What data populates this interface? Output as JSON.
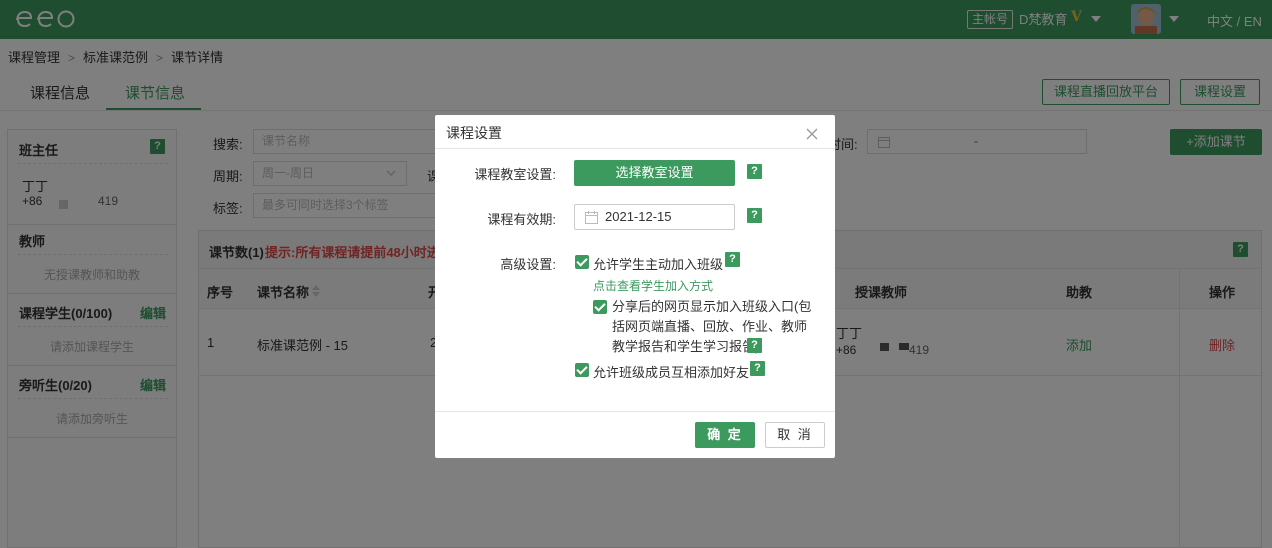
{
  "header": {
    "account_badge": "主帐号",
    "org_name": "D梵教育",
    "vip_mark": "V",
    "language": "中文 / EN"
  },
  "breadcrumb": [
    "课程管理",
    "标准课范例",
    "课节详情"
  ],
  "tabs": [
    {
      "label": "课程信息",
      "active": false
    },
    {
      "label": "课节信息",
      "active": true
    }
  ],
  "actions": {
    "live_platform": "课程直播回放平台",
    "course_settings": "课程设置",
    "add_lesson": "+添加课节"
  },
  "sidebar": {
    "head_teacher_title": "班主任",
    "head_teacher_name": "丁丁",
    "head_teacher_phone_prefix": "+86",
    "head_teacher_phone_suffix": "419",
    "teachers_title": "教师",
    "teachers_empty": "无授课教师和助教",
    "students_title": "课程学生(0/100)",
    "students_edit": "编辑",
    "students_empty": "请添加课程学生",
    "auditors_title": "旁听生(0/20)",
    "auditors_edit": "编辑",
    "auditors_empty": "请添加旁听生",
    "help": "?"
  },
  "filters": {
    "search_label": "搜索:",
    "search_placeholder": "课节名称",
    "cycle_label": "周期:",
    "cycle_value": "周一-周日",
    "tag_label": "标签:",
    "tag_placeholder": "最多可同时选择3个标签",
    "time_label": "时间:",
    "date_sep": "-",
    "partial_label": "课"
  },
  "table": {
    "count_label": "课节数(1)",
    "notice": "提示:所有课程请提前48小时进",
    "columns": [
      "序号",
      "课节名称",
      "开",
      "授课教师",
      "助教",
      "操作"
    ],
    "rows": [
      {
        "index": "1",
        "name": "标准课范例 - 15",
        "start_partial": "2",
        "teacher": "丁丁",
        "teacher_phone_prefix": "+86",
        "teacher_phone_suffix": "419",
        "assistant": "添加",
        "action": "删除"
      }
    ]
  },
  "modal": {
    "title": "课程设置",
    "classroom_label": "课程教室设置:",
    "classroom_button": "选择教室设置",
    "validity_label": "课程有效期:",
    "validity_date": "2021-12-15",
    "advanced_label": "高级设置:",
    "opt_join": "允许学生主动加入班级",
    "join_link": "点击查看学生加入方式",
    "opt_share": "分享后的网页显示加入班级入口(包括网页端直播、回放、作业、教师教学报告和学生学习报告)",
    "opt_friends": "允许班级成员互相添加好友",
    "ok": "确 定",
    "cancel": "取 消",
    "help": "?"
  },
  "colors": {
    "brand_green": "#3c9a5f",
    "danger_red": "#e04848",
    "vip_gold": "#e9c93d"
  }
}
